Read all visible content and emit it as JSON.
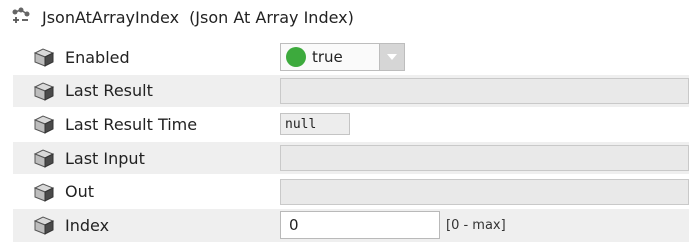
{
  "header": {
    "name": "JsonAtArrayIndex",
    "display_name": "(Json At Array Index)",
    "icon": "component-icon"
  },
  "slots": [
    {
      "label": "Enabled",
      "icon": "slot-cube-icon",
      "value": "true",
      "status_color": "#3daa3d"
    },
    {
      "label": "Last Result",
      "icon": "slot-cube-icon",
      "value": ""
    },
    {
      "label": "Last Result Time",
      "icon": "slot-cube-icon",
      "value": "null"
    },
    {
      "label": "Last Input",
      "icon": "slot-cube-icon",
      "value": ""
    },
    {
      "label": "Out",
      "icon": "slot-cube-icon",
      "value": ""
    },
    {
      "label": "Index",
      "icon": "slot-cube-icon",
      "value": "0",
      "range": "[0 - max]"
    }
  ]
}
